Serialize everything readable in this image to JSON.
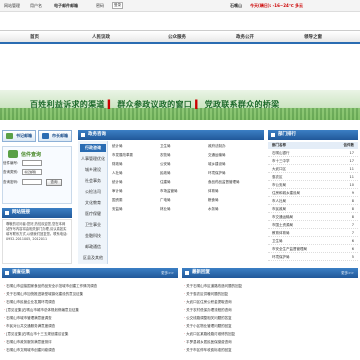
{
  "topbar": {
    "items": [
      "网站管理",
      "用户名",
      "密码"
    ],
    "login": "登录",
    "mail_hint": "电子邮件邮箱",
    "weather_city": "石嘴山",
    "weather": "今天(晴日): -16~24℃ 多云"
  },
  "nav": {
    "items": [
      "首页",
      "人民议政",
      "公众服务",
      "政务公开",
      "领导之窗"
    ]
  },
  "banner": {
    "slogan_a": "百姓利益诉求的渠道",
    "slogan_b": "群众参政议政的窗口",
    "slogan_c": "党政联系群众的桥梁"
  },
  "mail_buttons": {
    "write": "书记邮箱",
    "mayor": "市长邮箱"
  },
  "letter_query": {
    "title": "信件查询",
    "code_label": "信件编号:",
    "type_label": "查询类别:",
    "type_value": "书记邮箱",
    "pwd_label": "查询密码:",
    "search": "查询"
  },
  "contact": {
    "title": "网站链接",
    "body": "尊敬的访问者:您好,热忱欢迎您,您在本网站所写内容将由相关部门办理,请认真如实填写联系方式,以便我们回复您。联系电话: 0952-2011005, 2012011"
  },
  "middle": {
    "title": "政务咨询",
    "categories": [
      "行政咨询",
      "人事管理优化",
      "城乡建设",
      "社会事务",
      "公检法司",
      "文化教育",
      "医疗保健",
      "卫生事业",
      "金融科技",
      "邮政通信",
      "区县及其他"
    ],
    "departments": [
      [
        "统计局",
        "卫生局",
        "政府法制办"
      ],
      [
        "市发展改革委",
        "农牧局",
        "交通运输局"
      ],
      [
        "财政局",
        "公安局",
        "城乡建设局"
      ],
      [
        "人社局",
        "民政局",
        "环境保护局"
      ],
      [
        "统计局",
        "住建局",
        "食品药品监督管理局"
      ],
      [
        "审计局",
        "市场监管局",
        "体育局"
      ],
      [
        "国资委",
        "广电局",
        "粮食局"
      ],
      [
        "安监局",
        "林业局",
        "水务局"
      ]
    ]
  },
  "right": {
    "title": "部门排行",
    "col_name": "部门名称",
    "col_count": "信件数",
    "rows": [
      {
        "name": "石嘴山银行",
        "count": "17"
      },
      {
        "name": "市十三中学",
        "count": "17"
      },
      {
        "name": "大武口区",
        "count": "11"
      },
      {
        "name": "惠农区",
        "count": "11"
      },
      {
        "name": "市公安局",
        "count": "10"
      },
      {
        "name": "住房和城乡建设局",
        "count": "9"
      },
      {
        "name": "市人社局",
        "count": "8"
      },
      {
        "name": "市民政局",
        "count": "8"
      },
      {
        "name": "市交通运输局",
        "count": "8"
      },
      {
        "name": "市国土资源局",
        "count": "7"
      },
      {
        "name": "教育体育局",
        "count": "7"
      },
      {
        "name": "卫生局",
        "count": "6"
      },
      {
        "name": "市安全生产监督管理局",
        "count": "6"
      },
      {
        "name": "环境保护局",
        "count": "5"
      }
    ]
  },
  "bottom_left": {
    "title": "调查征集",
    "more": "更多>>",
    "items": [
      "石嘴山市迎接国家食品药品安全示范城市创建工作情况调查",
      "关于石嘴山市加快推进新型城镇化建设的意见征集",
      "石嘴山市民营企业发展环境调查",
      "[意见征集]石嘴山市城市总体规划修编意见征集",
      "石嘴山市城市管理满意度调查",
      "市民对公共交通服务满意度调查",
      "[意见征集]石嘴山市十三五规划建议征集",
      "石嘴山市政务服务满意度测评",
      "石嘴山市文明城市创建问卷调查"
    ]
  },
  "bottom_right": {
    "title": "最新回复",
    "more": "更多>>",
    "items": [
      "关于石嘴山市区道路改造问题的回复",
      "关于惠农区供暖问题的回复",
      "大武口区住房公积金提取咨询",
      "关于农村低保办理流程的咨询",
      "公交线路调整相关问题的答复",
      "关于小区物业管理问题的回复",
      "大武口区某路段路灯维修的回复",
      "平罗县城乡居民医保缴费咨询",
      "关于市区停车收费标准的回复"
    ]
  }
}
